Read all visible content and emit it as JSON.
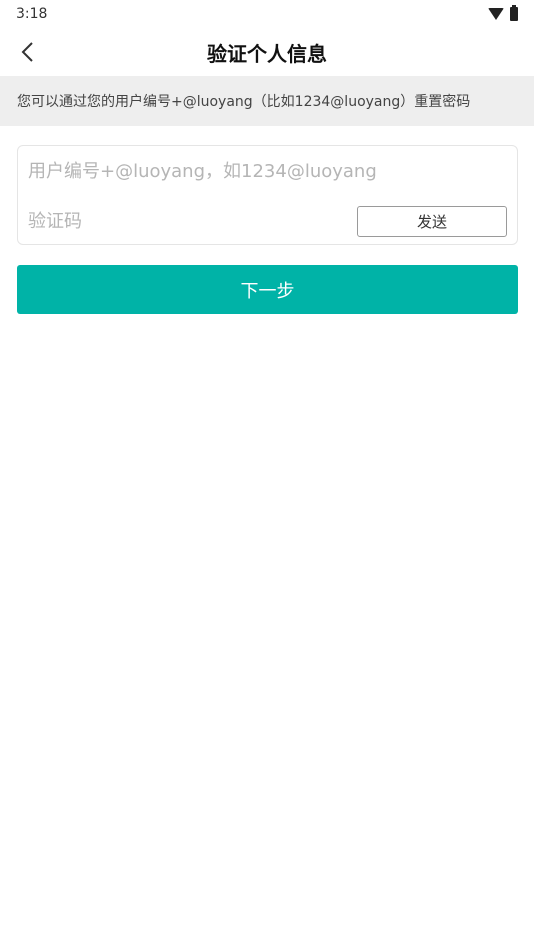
{
  "status_bar": {
    "time": "3:18",
    "icons": [
      "wifi-icon",
      "battery-icon"
    ]
  },
  "nav": {
    "back_icon": "chevron-left-icon",
    "title": "验证个人信息"
  },
  "hint": {
    "text": "您可以通过您的用户编号+@luoyang（比如1234@luoyang）重置密码"
  },
  "form": {
    "username": {
      "value": "",
      "placeholder": "用户编号+@luoyang，如1234@luoyang"
    },
    "code": {
      "value": "",
      "placeholder": "验证码"
    },
    "send_label": "发送"
  },
  "next_label": "下一步",
  "colors": {
    "accent": "#00b3a7",
    "hint_background": "#eeeeee"
  }
}
